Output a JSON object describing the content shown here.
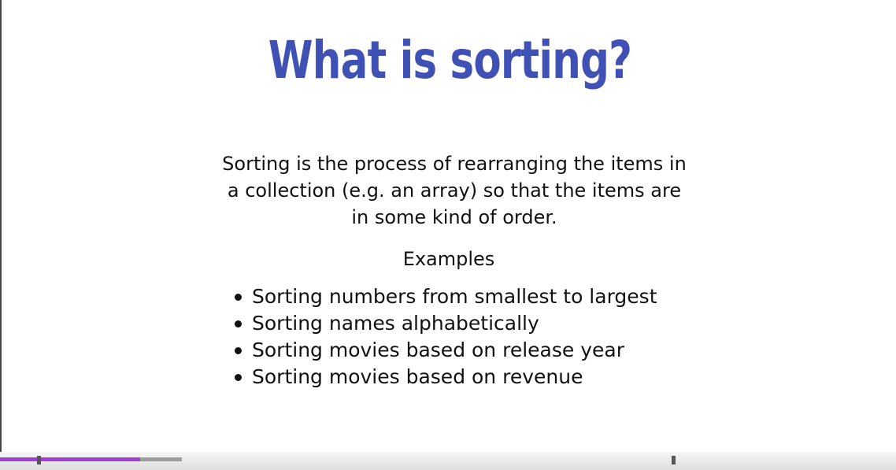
{
  "slide": {
    "title": "What is sorting?",
    "intro": "Sorting is the process of rearranging the items in a collection (e.g. an array) so that the items are in some kind of order.",
    "examples_heading": "Examples",
    "examples": [
      "Sorting numbers from smallest to largest",
      "Sorting names alphabetically",
      "Sorting movies based on release year",
      "Sorting movies based on revenue"
    ]
  },
  "player": {
    "progress": 0.77,
    "colors": {
      "progress": "#a33bd6",
      "buffer": "#9e9e9e"
    }
  },
  "colors": {
    "title": "#3f51b5",
    "text": "#111111"
  }
}
